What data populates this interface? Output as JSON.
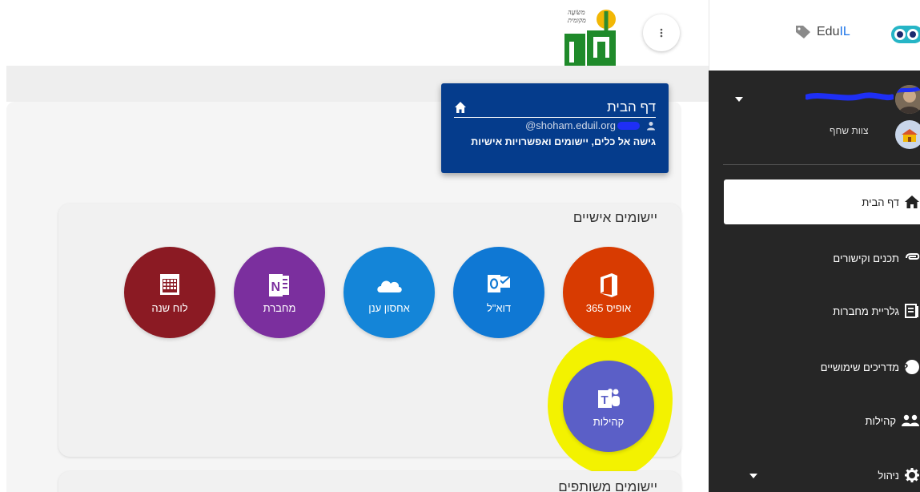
{
  "home_card": {
    "title": "דף הבית",
    "email_domain": "@shoham.eduil.org",
    "description": "גישה אל כלים, יישומים ואפשרויות אישיות"
  },
  "personal_apps": {
    "title": "יישומים אישיים",
    "apps": [
      {
        "label": "אופיס 365",
        "color": "#d83b01",
        "icon": "office-icon"
      },
      {
        "label": "דוא\"ל",
        "color": "#0f78d4",
        "icon": "outlook-icon"
      },
      {
        "label": "אחסון ענן",
        "color": "#1485d8",
        "icon": "onedrive-icon"
      },
      {
        "label": "מחברת",
        "color": "#7b2f9e",
        "icon": "onenote-icon"
      },
      {
        "label": "לוח שנה",
        "color": "#8b1a23",
        "icon": "calendar-icon"
      },
      {
        "label": "קהילות",
        "color": "#5b5fc7",
        "icon": "teams-icon"
      }
    ]
  },
  "shared_apps": {
    "title": "יישומים משותפים"
  },
  "header": {
    "brand_label": "EduIL",
    "brand_label_a": "Edu",
    "brand_label_b": "IL"
  },
  "sidebar": {
    "team_label": "צוות שחף",
    "items": [
      {
        "label": "דף הבית",
        "icon": "home-icon"
      },
      {
        "label": "תכנים וקישורים",
        "icon": "link-icon"
      },
      {
        "label": "גלריית מחברות",
        "icon": "gallery-icon"
      },
      {
        "label": "מדריכים שימושיים",
        "icon": "help-icon"
      },
      {
        "label": "קהילות",
        "icon": "people-icon"
      },
      {
        "label": "ניהול",
        "icon": "gear-icon"
      }
    ]
  },
  "colors": {
    "home_card_bg": "#053c8c",
    "sidebar_bg": "#262626",
    "highlight": "#f3f200"
  }
}
